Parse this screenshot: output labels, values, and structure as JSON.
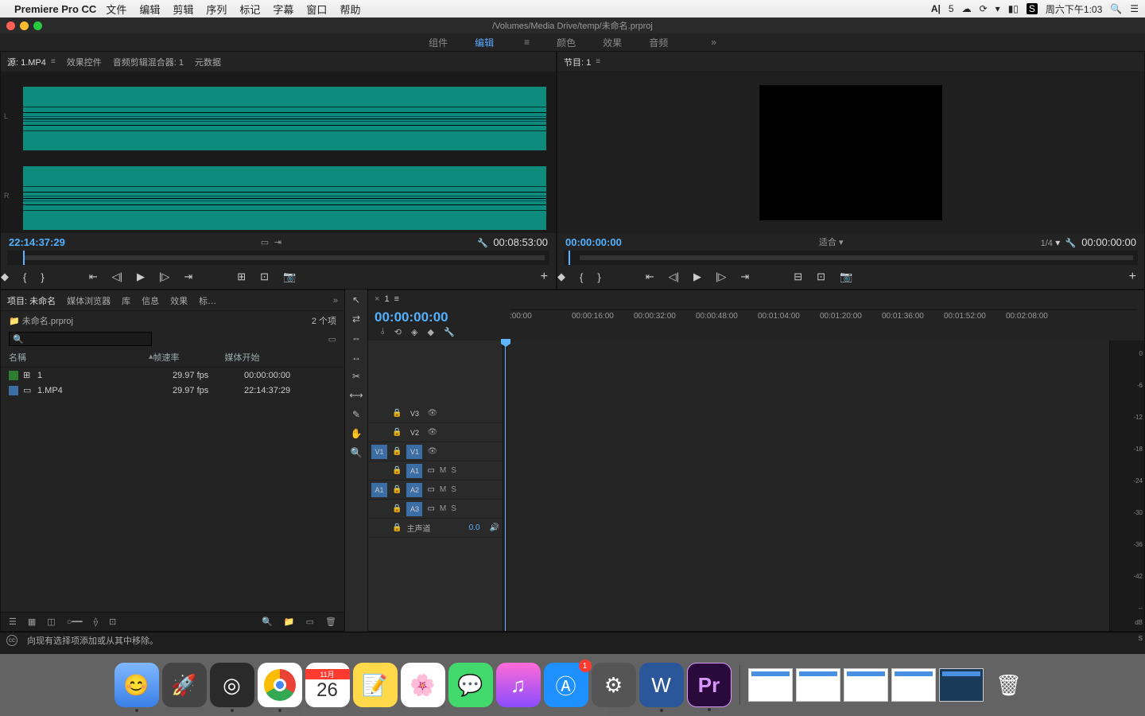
{
  "menubar": {
    "app": "Premiere Pro CC",
    "items": [
      "文件",
      "编辑",
      "剪辑",
      "序列",
      "标记",
      "字幕",
      "窗口",
      "帮助"
    ],
    "right": {
      "adobe": "5",
      "clock": "周六下午1:03"
    }
  },
  "titlebar": "/Volumes/Media Drive/temp/未命名.prproj",
  "workspaces": [
    "组件",
    "编辑",
    "颜色",
    "效果",
    "音频"
  ],
  "workspace_active": 1,
  "source": {
    "tabs": [
      "源: 1.MP4",
      "效果控件",
      "音频剪辑混合器: 1",
      "元数据"
    ],
    "tc_left": "22:14:37:29",
    "tc_right": "00:08:53:00"
  },
  "program": {
    "tab": "节目: 1",
    "tc_left": "00:00:00:00",
    "fit": "适合",
    "scale": "1/4",
    "tc_right": "00:00:00:00"
  },
  "project": {
    "tabs": [
      "项目: 未命名",
      "媒体浏览器",
      "库",
      "信息",
      "效果",
      "标…"
    ],
    "file": "未命名.prproj",
    "count": "2 个项",
    "cols": {
      "name": "名稱",
      "fps": "帧速率",
      "start": "媒体开始"
    },
    "items": [
      {
        "color": "#2e7d32",
        "name": "1",
        "fps": "29.97 fps",
        "start": "00:00:00:00"
      },
      {
        "color": "#3b6ea5",
        "name": "1.MP4",
        "fps": "29.97 fps",
        "start": "22:14:37:29"
      }
    ]
  },
  "timeline": {
    "seq": "1",
    "tc": "00:00:00:00",
    "ruler": [
      ":00:00",
      "00:00:16:00",
      "00:00:32:00",
      "00:00:48:00",
      "00:01:04:00",
      "00:01:20:00",
      "00:01:36:00",
      "00:01:52:00",
      "00:02:08:00"
    ],
    "tracks": {
      "v": [
        "V3",
        "V2",
        "V1"
      ],
      "a": [
        "A1",
        "A2",
        "A3"
      ],
      "vsrc": "V1",
      "asrc": "A1",
      "master": "主声道",
      "master_val": "0.0"
    }
  },
  "meters": [
    "0",
    "-6",
    "-12",
    "-18",
    "-24",
    "-30",
    "-36",
    "-42",
    "--",
    "dB",
    "S",
    "S"
  ],
  "status": "向现有选择项添加或从其中移除。",
  "dock": {
    "badge": "1",
    "cal_month": "11月",
    "cal_day": "26"
  }
}
